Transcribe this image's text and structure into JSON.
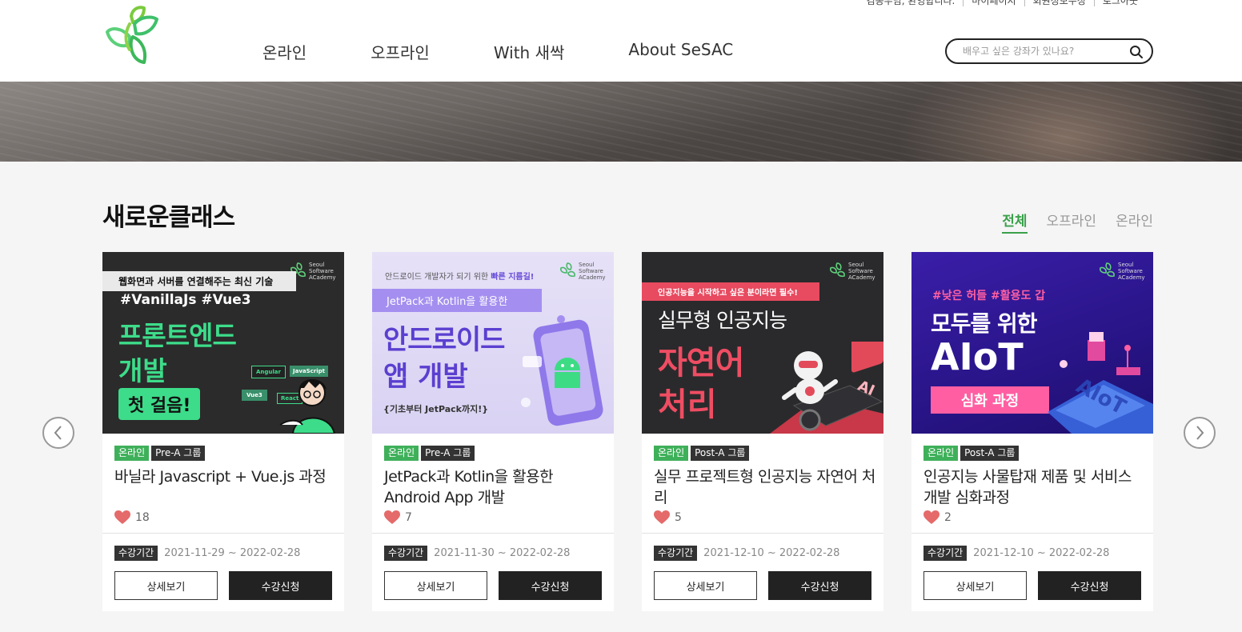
{
  "header": {
    "util": [
      "김종우님, 환영합니다.",
      "마이페이지",
      "회원정보수정",
      "로그아웃"
    ],
    "nav": [
      "온라인",
      "오프라인",
      "With 새싹",
      "About SeSAC"
    ],
    "search_placeholder": "배우고 싶은 강좌가 있나요?"
  },
  "section": {
    "title": "새로운클래스",
    "filters": [
      "전체",
      "오프라인",
      "온라인"
    ],
    "active_filter": "전체"
  },
  "colors": {
    "accent": "#3aa04a",
    "tag_green": "#3fb05a",
    "dark": "#222222",
    "heart": "#e05a5a"
  },
  "cards": [
    {
      "tags": [
        "온라인",
        "Pre-A 그룹"
      ],
      "title": "바닐라 Javascript + Vue.js 과정",
      "likes": "18",
      "period_label": "수강기간",
      "period": "2021-11-29 ~ 2022-02-28",
      "detail_label": "상세보기",
      "apply_label": "수강신청",
      "thumb": {
        "logo": [
          "Seoul",
          "Software",
          "ACademy"
        ],
        "caption": "웹화면과 서버를 연결해주는 최신 기술",
        "hashtags": "#VanillaJs #Vue3",
        "headline1": "프론트엔드",
        "headline2": "개발",
        "badge": "첫 걸음!",
        "chips": [
          "Angular",
          "JavaScript",
          "Vue3",
          "React"
        ]
      }
    },
    {
      "tags": [
        "온라인",
        "Pre-A 그룹"
      ],
      "title": "JetPack과 Kotlin을 활용한 Android App 개발",
      "likes": "7",
      "period_label": "수강기간",
      "period": "2021-11-30 ~ 2022-02-28",
      "detail_label": "상세보기",
      "apply_label": "수강신청",
      "thumb": {
        "logo": [
          "Seoul",
          "Software",
          "ACademy"
        ],
        "caption_a": "안드로이드 개발자가 되기 위한 ",
        "caption_b": "빠른 지름길!",
        "band": "JetPack과 Kotlin을 활용한",
        "headline1": "안드로이드",
        "headline2": "앱 개발",
        "sub": "{기초부터 JetPack까지!}"
      }
    },
    {
      "tags": [
        "온라인",
        "Post-A 그룹"
      ],
      "title": "실무 프로젝트형 인공지능 자연어 처리",
      "likes": "5",
      "period_label": "수강기간",
      "period": "2021-12-10 ~ 2022-02-28",
      "detail_label": "상세보기",
      "apply_label": "수강신청",
      "thumb": {
        "logo": [
          "Seoul",
          "Software",
          "ACademy"
        ],
        "band": "인공지능을 시작하고 싶은 분이라면 필수!",
        "headline1": "실무형 인공지능",
        "headline2": "자연어",
        "headline3": "처리",
        "ai": "AI"
      }
    },
    {
      "tags": [
        "온라인",
        "Post-A 그룹"
      ],
      "title": "인공지능 사물탑재 제품 및 서비스 개발 심화과정",
      "likes": "2",
      "period_label": "수강기간",
      "period": "2021-12-10 ~ 2022-02-28",
      "detail_label": "상세보기",
      "apply_label": "수강신청",
      "thumb": {
        "logo": [
          "Seoul",
          "Software",
          "ACademy"
        ],
        "hashtags": "#낮은 허들 #활용도 갑",
        "headline1": "모두를 위한",
        "headline2": "AIoT",
        "band": "심화 과정",
        "deco": "AIoT"
      }
    }
  ]
}
